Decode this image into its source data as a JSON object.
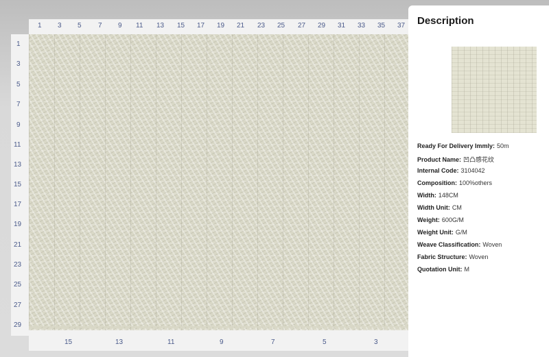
{
  "ruler": {
    "top": [
      "1",
      "3",
      "5",
      "7",
      "9",
      "11",
      "13",
      "15",
      "17",
      "19",
      "21",
      "23",
      "25",
      "27",
      "29",
      "31",
      "33",
      "35",
      "37"
    ],
    "left": [
      "1",
      "3",
      "5",
      "7",
      "9",
      "11",
      "13",
      "15",
      "17",
      "19",
      "21",
      "23",
      "25",
      "27",
      "29"
    ],
    "bottom": [
      "15",
      "13",
      "11",
      "9",
      "7",
      "5",
      "3"
    ]
  },
  "panel": {
    "title": "Description",
    "specs": [
      {
        "label": "Ready For Delivery Immly:",
        "value": "50m"
      },
      {
        "label": "Product Name:",
        "value": "凹凸感花纹"
      },
      {
        "label": "Internal Code:",
        "value": "3104042"
      },
      {
        "label": "Composition:",
        "value": "100%others"
      },
      {
        "label": "Width:",
        "value": "148CM"
      },
      {
        "label": "Width Unit:",
        "value": "CM"
      },
      {
        "label": "Weight:",
        "value": "600G/M"
      },
      {
        "label": "Weight Unit:",
        "value": "G/M"
      },
      {
        "label": "Weave Classification:",
        "value": "Woven"
      },
      {
        "label": "Fabric Structure:",
        "value": "Woven"
      },
      {
        "label": "Quotation Unit:",
        "value": "M"
      }
    ]
  },
  "colors": {
    "fabric": "#d9d8c7",
    "ruler_text": "#4a5a8a",
    "panel_bg": "#ffffff"
  }
}
